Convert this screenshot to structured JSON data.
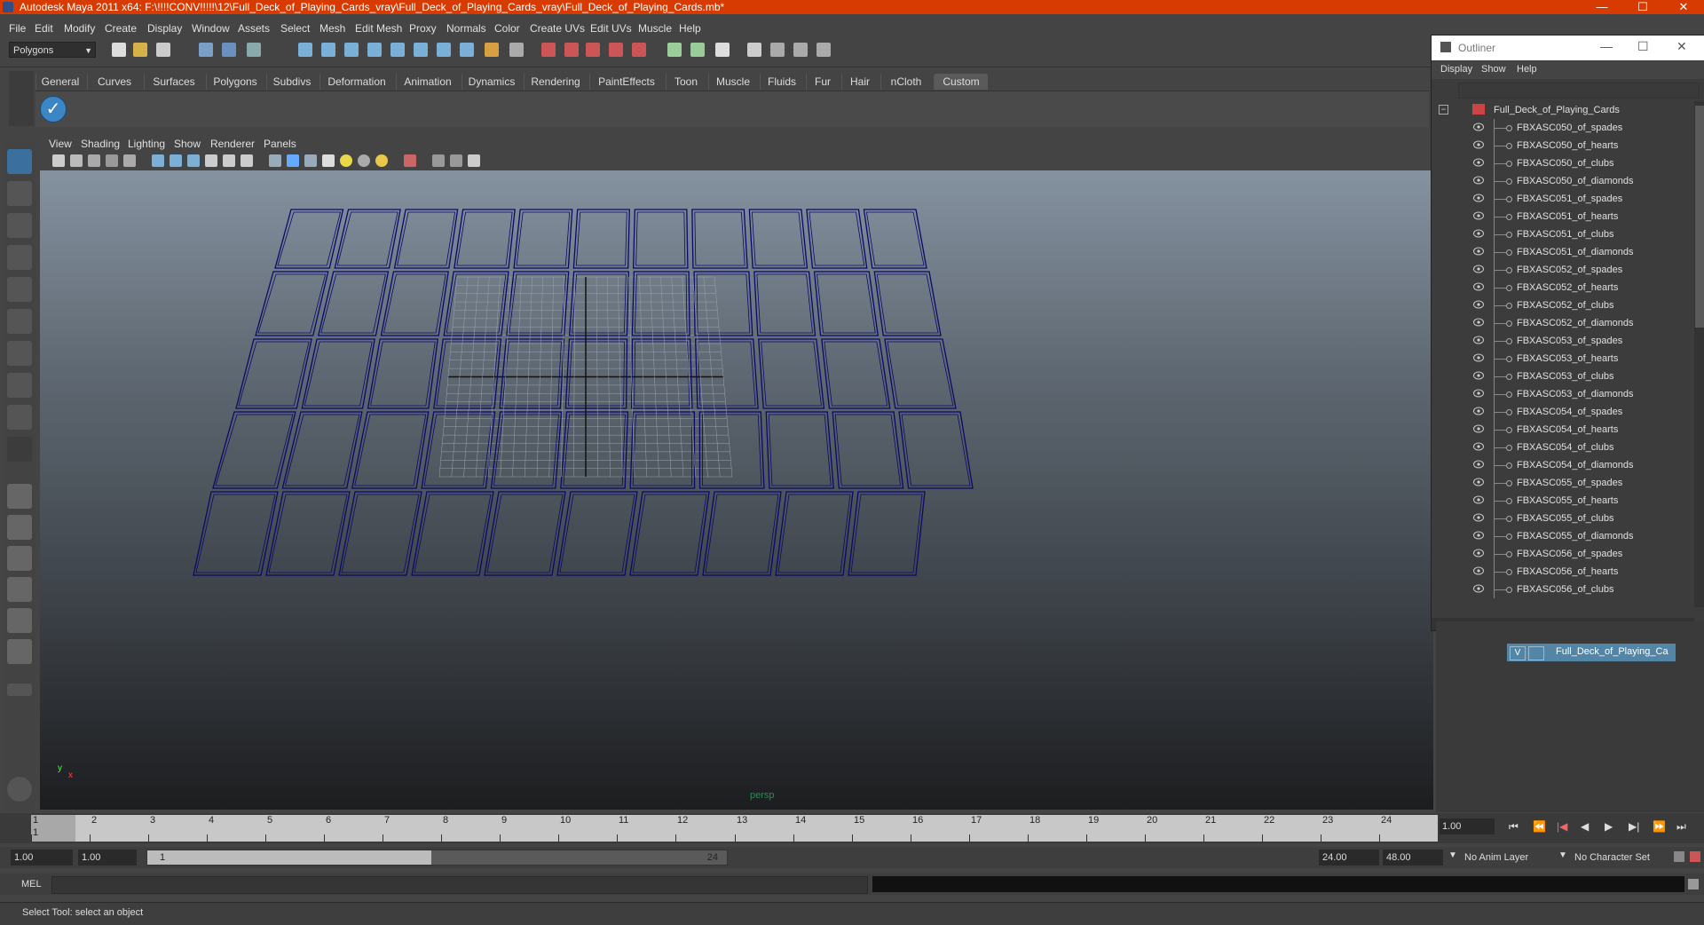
{
  "window": {
    "title": "Autodesk Maya 2011 x64: F:\\!!!!CONV!!!!!\\12\\Full_Deck_of_Playing_Cards_vray\\Full_Deck_of_Playing_Cards_vray\\Full_Deck_of_Playing_Cards.mb*",
    "minimize": "—",
    "maximize": "☐",
    "close": "✕"
  },
  "menubar": [
    "File",
    "Edit",
    "Modify",
    "Create",
    "Display",
    "Window",
    "Assets",
    "Select",
    "Mesh",
    "Edit Mesh",
    "Proxy",
    "Normals",
    "Color",
    "Create UVs",
    "Edit UVs",
    "Muscle",
    "Help"
  ],
  "statusline": {
    "mode": "Polygons"
  },
  "shelf": {
    "tabs": [
      "General",
      "Curves",
      "Surfaces",
      "Polygons",
      "Subdivs",
      "Deformation",
      "Animation",
      "Dynamics",
      "Rendering",
      "PaintEffects",
      "Toon",
      "Muscle",
      "Fluids",
      "Fur",
      "Hair",
      "nCloth",
      "Custom"
    ],
    "active_tab": "Custom"
  },
  "viewport": {
    "menu": [
      "View",
      "Shading",
      "Lighting",
      "Show",
      "Renderer",
      "Panels"
    ],
    "camera_label": "persp",
    "axis_y": "y",
    "axis_x": "x"
  },
  "outliner": {
    "title": "Outliner",
    "menu": [
      "Display",
      "Show",
      "Help"
    ],
    "root": "Full_Deck_of_Playing_Cards",
    "items": [
      "FBXASC050_of_spades",
      "FBXASC050_of_hearts",
      "FBXASC050_of_clubs",
      "FBXASC050_of_diamonds",
      "FBXASC051_of_spades",
      "FBXASC051_of_hearts",
      "FBXASC051_of_clubs",
      "FBXASC051_of_diamonds",
      "FBXASC052_of_spades",
      "FBXASC052_of_hearts",
      "FBXASC052_of_clubs",
      "FBXASC052_of_diamonds",
      "FBXASC053_of_spades",
      "FBXASC053_of_hearts",
      "FBXASC053_of_clubs",
      "FBXASC053_of_diamonds",
      "FBXASC054_of_spades",
      "FBXASC054_of_hearts",
      "FBXASC054_of_clubs",
      "FBXASC054_of_diamonds",
      "FBXASC055_of_spades",
      "FBXASC055_of_hearts",
      "FBXASC055_of_clubs",
      "FBXASC055_of_diamonds",
      "FBXASC056_of_spades",
      "FBXASC056_of_hearts",
      "FBXASC056_of_clubs"
    ]
  },
  "layers": {
    "visible_flag": "V",
    "layer_name": "Full_Deck_of_Playing_Ca"
  },
  "timeline": {
    "ticks": [
      "1",
      "2",
      "3",
      "4",
      "5",
      "6",
      "7",
      "8",
      "9",
      "10",
      "11",
      "12",
      "13",
      "14",
      "15",
      "16",
      "17",
      "18",
      "19",
      "20",
      "21",
      "22",
      "23",
      "24"
    ],
    "current_frame_marker": "1",
    "current_time": "1.00"
  },
  "playback": {
    "buttons": [
      "⏮",
      "⏪",
      "|◀",
      "◀",
      "▶",
      "▶|",
      "⏩",
      "⏭"
    ]
  },
  "range": {
    "start_time": "1.00",
    "playback_start": "1.00",
    "slider_start": "1",
    "slider_end": "24",
    "playback_end": "24.00",
    "end_time": "48.00",
    "anim_layer": "No Anim Layer",
    "character_set": "No Character Set"
  },
  "command": {
    "label": "MEL"
  },
  "helpline": {
    "text": "Select Tool: select an object"
  },
  "colors": {
    "title_bar": "#d83b01",
    "wireframe": "#0a0a6a",
    "layer_highlight": "#5285a6"
  }
}
